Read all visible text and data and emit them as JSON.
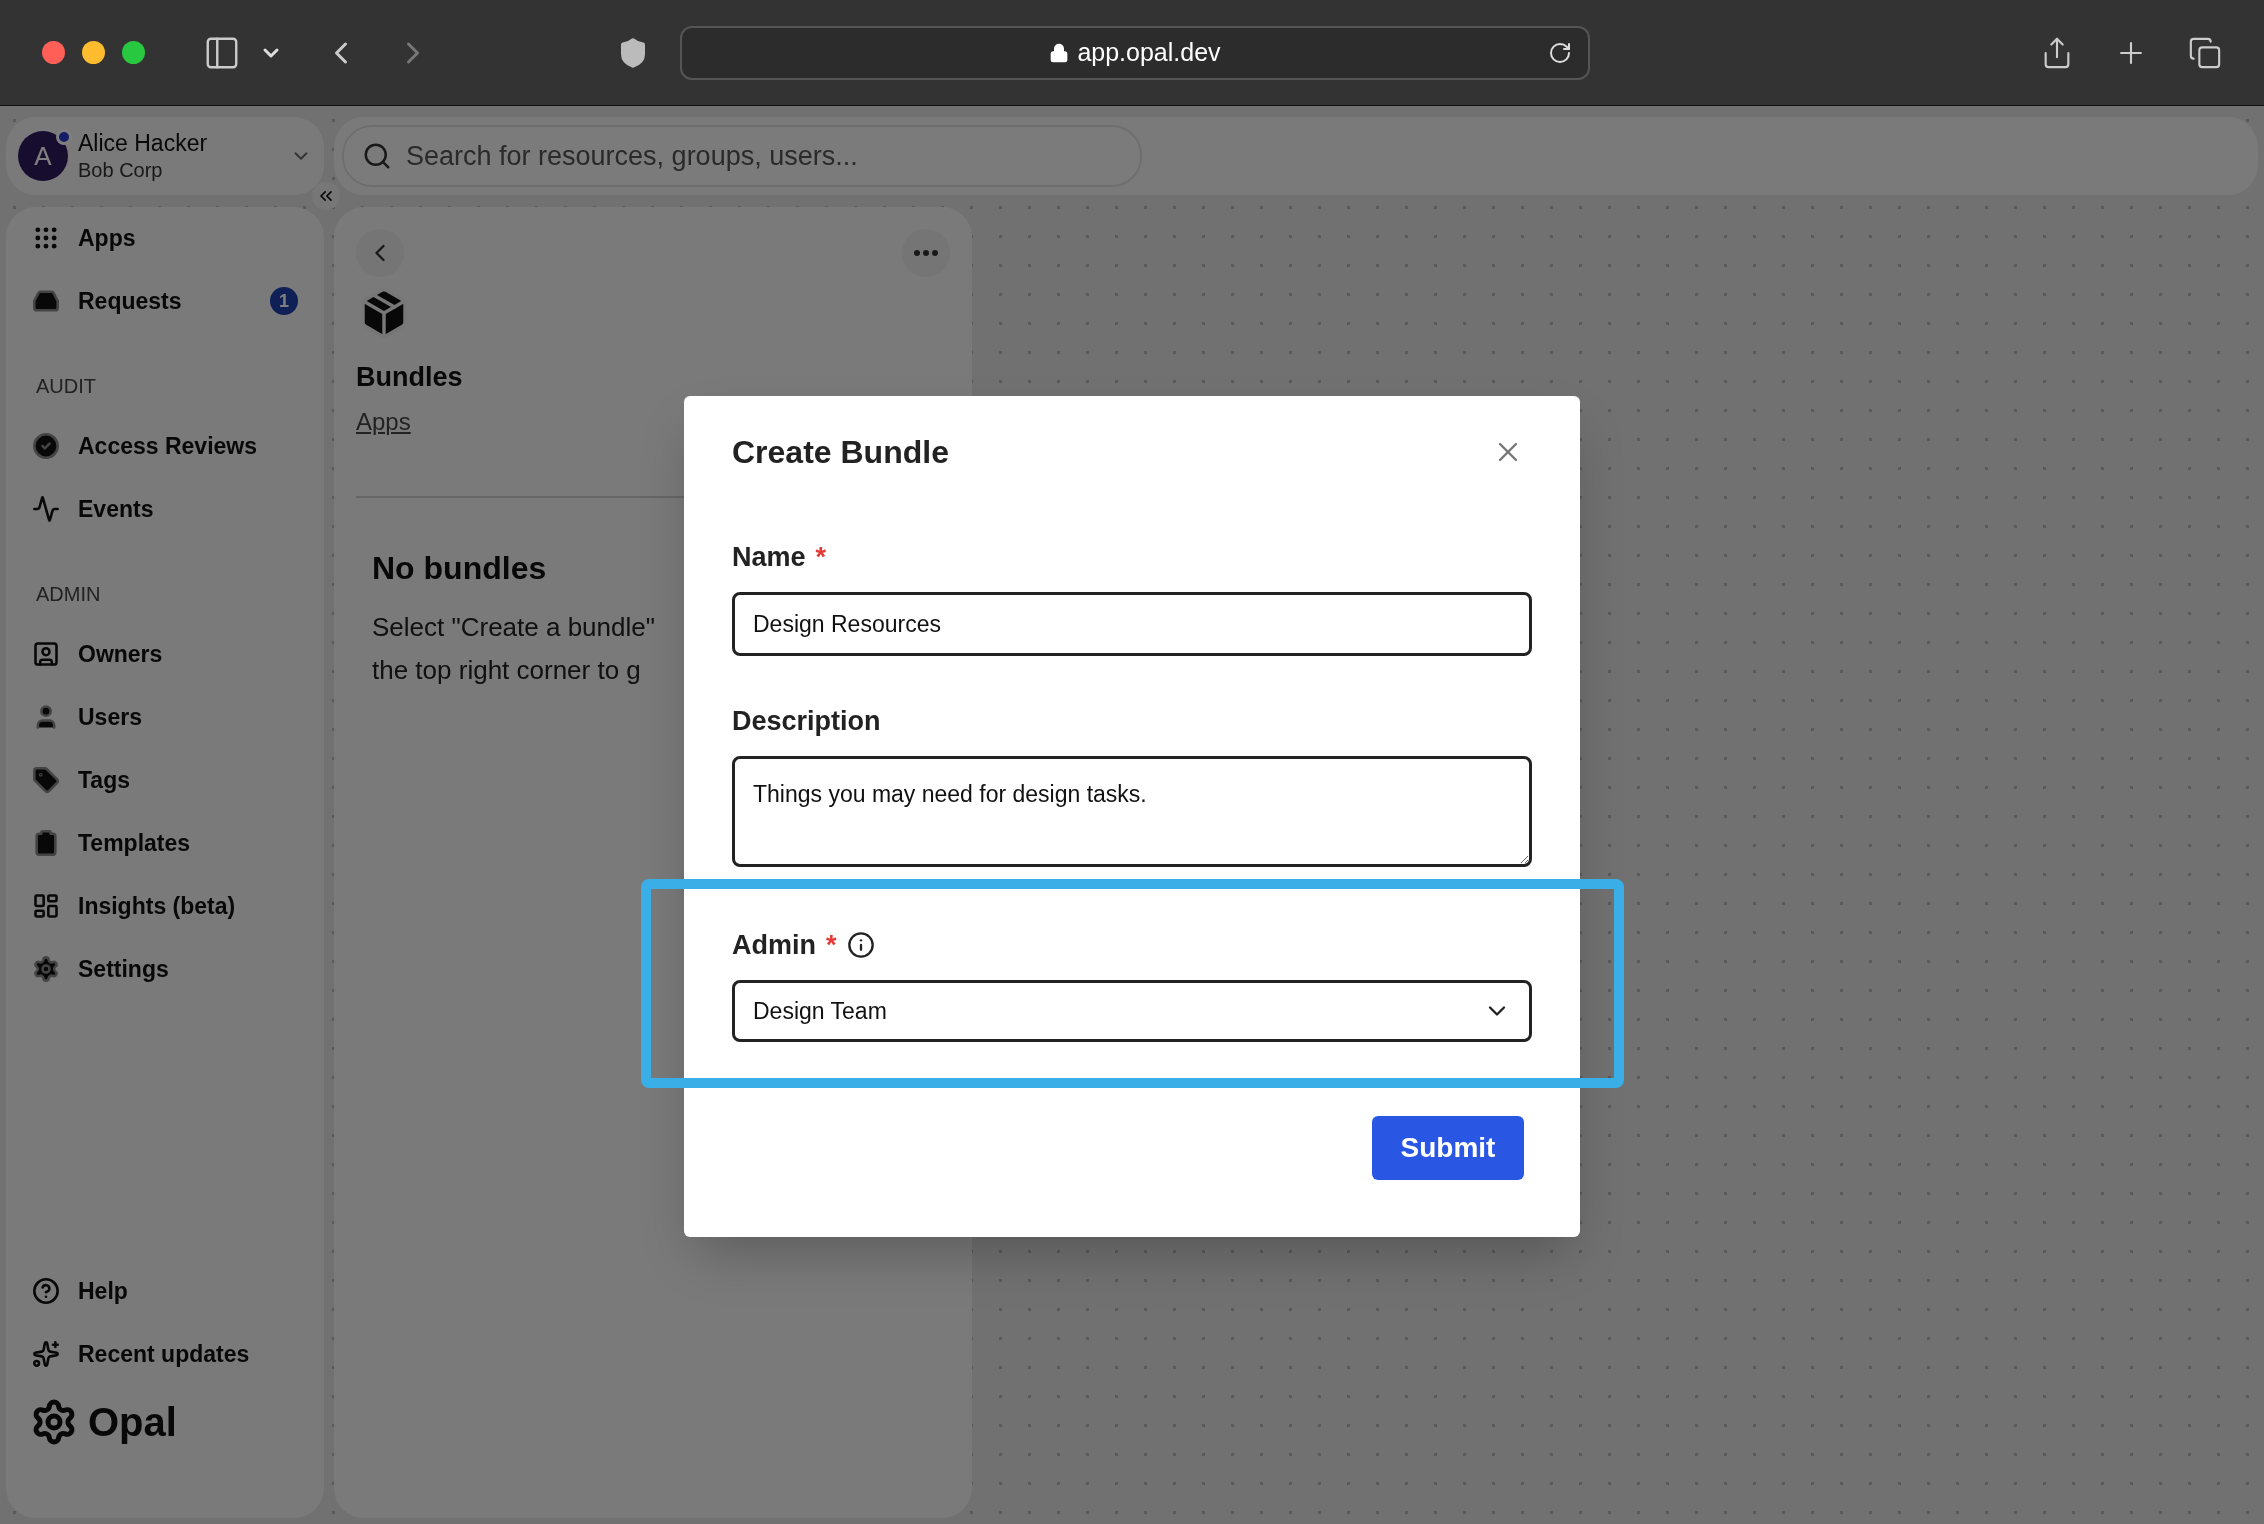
{
  "browser": {
    "url": "app.opal.dev"
  },
  "user": {
    "initial": "A",
    "name": "Alice Hacker",
    "org": "Bob Corp"
  },
  "search": {
    "placeholder": "Search for resources, groups, users..."
  },
  "sidebar": {
    "items": [
      {
        "label": "Apps"
      },
      {
        "label": "Requests",
        "badge": "1"
      }
    ],
    "sections": [
      {
        "heading": "AUDIT",
        "items": [
          {
            "label": "Access Reviews"
          },
          {
            "label": "Events"
          }
        ]
      },
      {
        "heading": "ADMIN",
        "items": [
          {
            "label": "Owners"
          },
          {
            "label": "Users"
          },
          {
            "label": "Tags"
          },
          {
            "label": "Templates"
          },
          {
            "label": "Insights (beta)"
          },
          {
            "label": "Settings"
          }
        ]
      }
    ],
    "footer_items": [
      {
        "label": "Help"
      },
      {
        "label": "Recent updates"
      }
    ],
    "logo": "Opal"
  },
  "panel": {
    "title": "Bundles",
    "breadcrumb": "Apps",
    "empty_title": "No bundles",
    "empty_lines": [
      "Select \"Create a bundle\"",
      "the top right corner to g"
    ]
  },
  "dialog": {
    "title": "Create Bundle",
    "fields": [
      {
        "kind": "text",
        "label": "Name",
        "required_mark": "*",
        "value": "Design Resources"
      },
      {
        "kind": "textarea",
        "label": "Description",
        "value": "Things you may need for design tasks."
      },
      {
        "kind": "select",
        "label": "Admin",
        "required_mark": "*",
        "info": true,
        "highlighted": true,
        "value": "Design Team"
      }
    ],
    "submit": "Submit"
  }
}
